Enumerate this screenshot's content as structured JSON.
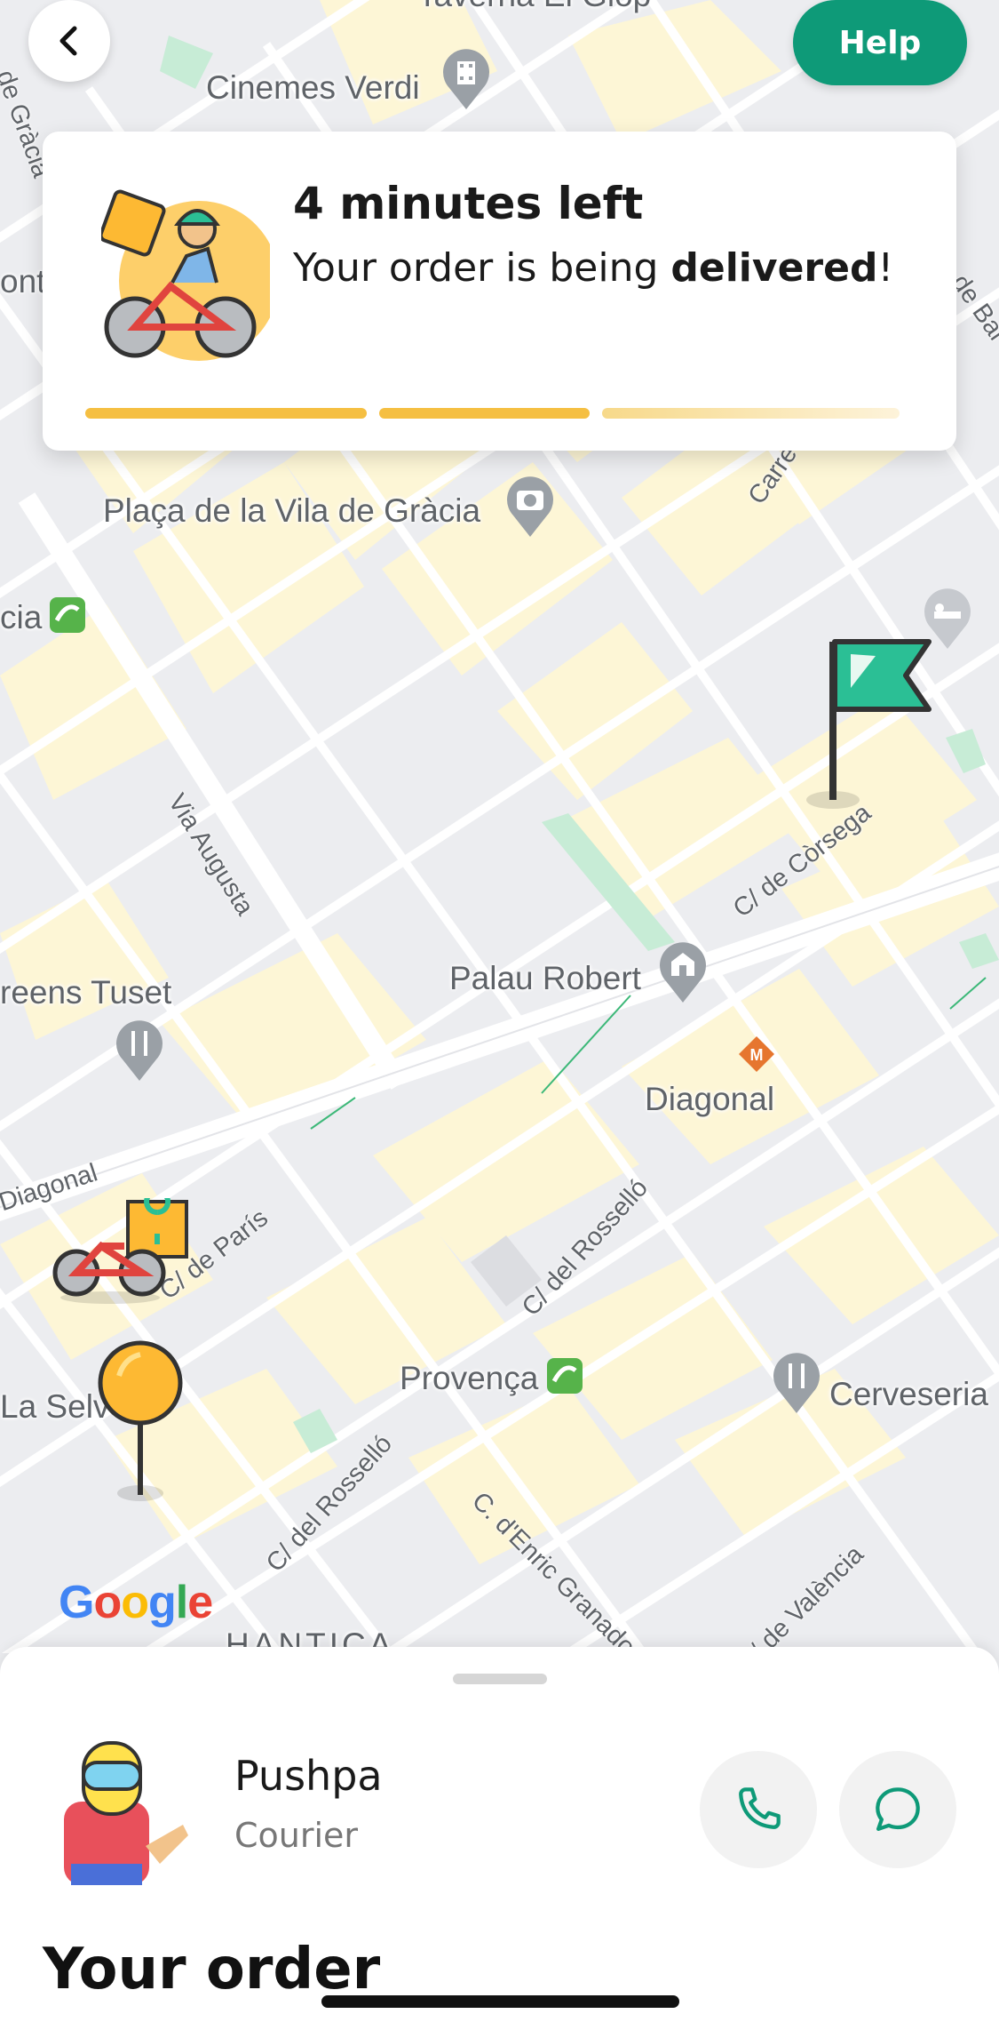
{
  "map": {
    "labels": {
      "cinemes_verdi": "Cinemes Verdi",
      "placa_vila_gracia": "Plaça de la Vila de Gràcia",
      "palau_robert": "Palau Robert",
      "greens_tuset": "reens Tuset",
      "diagonal_metro": "Diagonal",
      "provenca": "Provença",
      "cerveseria": "Cerveseria",
      "la_selva": "La Selv",
      "cia": "cia",
      "onta": "onta",
      "taverna_top": "Taverna El Glop",
      "hantica": "HANTICA"
    },
    "streets": {
      "via_augusta": "Via Augusta",
      "c_corsega": "C/ de Còrsega",
      "diagonal": "Diagonal",
      "c_paris": "C/ de París",
      "c_rossello_1": "C/ del Rosselló",
      "c_rossello_2": "C/ del Rosselló",
      "c_granados": "C. d'Enric Granados",
      "c_valencia": "C/ de València",
      "de_gracia": "de Gràcia",
      "carrer": "Carre",
      "de_bal": "de Bal"
    },
    "google_logo": "Google"
  },
  "header": {
    "help_label": "Help"
  },
  "status": {
    "title": "4 minutes left",
    "subtitle_prefix": "Your order is being ",
    "subtitle_bold": "delivered",
    "subtitle_suffix": "!",
    "progress_segments_completed": 2,
    "progress_segments_total": 3
  },
  "courier": {
    "name": "Pushpa",
    "role": "Courier"
  },
  "order": {
    "title": "Your order"
  },
  "colors": {
    "brand_green": "#0e9a78",
    "progress_yellow": "#f5bf42",
    "progress_pending": "#fbedc7",
    "flag_green": "#2bbf95",
    "pin_yellow": "#fdb933"
  }
}
